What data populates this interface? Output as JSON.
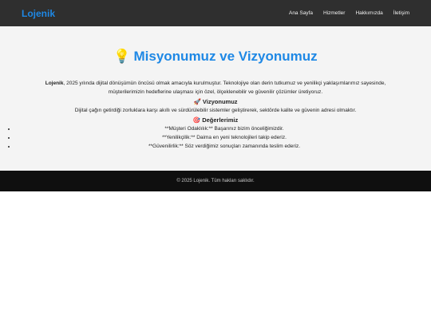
{
  "header": {
    "brand": "Lojenik",
    "nav": [
      {
        "label": "Ana Sayfa"
      },
      {
        "label": "Hizmetler"
      },
      {
        "label": "Hakkımızda"
      },
      {
        "label": "İletişim"
      }
    ]
  },
  "main": {
    "title_icon": "💡",
    "title": "Misyonumuz ve Vizyonumuz",
    "intro_brand": "Lojenik",
    "intro_line1": ", 2025 yılında dijital dönüşümün öncüsü olmak amacıyla kurulmuştur. Teknolojiye olan derin tutkumuz ve yenilikçi yaklaşımlarımız sayesinde,",
    "intro_line2": "müşterilerimizin hedeflerine ulaşması için özel, ölçeklenebilir ve güvenilir çözümler üretiyoruz.",
    "vision_icon": "🚀",
    "vision_heading": "Vizyonumuz",
    "vision_text": "Dijital çağın getirdiği zorluklara karşı akıllı ve sürdürülebilir sistemler geliştirerek, sektörde kalite ve güvenin adresi olmaktır.",
    "values_icon": "🎯",
    "values_heading": "Değerlerimiz",
    "values": [
      "**Müşteri Odaklılık:** Başarınız bizim önceliğimizdir.",
      "**Yenilikçilik:** Daima en yeni teknolojileri takip ederiz.",
      "**Güvenilirlik:** Söz verdiğimiz sonuçları zamanında teslim ederiz."
    ]
  },
  "footer": {
    "text": "© 2025 Lojenik. Tüm hakları saklıdır."
  }
}
